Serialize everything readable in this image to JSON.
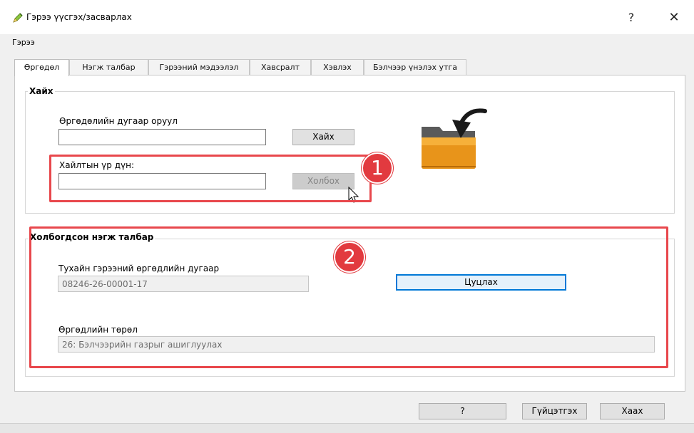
{
  "window": {
    "title": "Гэрээ үүсгэх/засварлах",
    "help_glyph": "?",
    "close_glyph": "✕"
  },
  "menu": {
    "items": [
      "Гэрээ"
    ]
  },
  "tabs": [
    {
      "label": "Өргөдөл",
      "active": true
    },
    {
      "label": "Нэгж талбар",
      "active": false
    },
    {
      "label": "Гэрээний мэдээлэл",
      "active": false
    },
    {
      "label": "Хавсралт",
      "active": false
    },
    {
      "label": "Хэвлэх",
      "active": false
    },
    {
      "label": "Бэлчээр үнэлэх утга",
      "active": false
    }
  ],
  "search_group": {
    "title": "Хайх",
    "app_number_label": "Өргөдөлийн дугаар оруул",
    "app_number_value": "",
    "search_button": "Хайх",
    "result_label": "Хайлтын үр дүн:",
    "result_value": "",
    "link_button": "Холбох"
  },
  "linked_group": {
    "title": "Холбогдсон нэгж талбар",
    "app_number_label": "Тухайн гэрээний өргөдлийн дугаар",
    "app_number_value": "08246-26-00001-17",
    "cancel_button": "Цуцлах",
    "app_type_label": "Өргөдлийн төрөл",
    "app_type_value": "26: Бэлчээрийн газрыг ашиглуулах"
  },
  "annotations": {
    "badge1": "1",
    "badge2": "2",
    "color": "#e23a3f"
  },
  "footer": {
    "help_button": "?",
    "apply_button": "Гүйцэтгэх",
    "close_button": "Хаах"
  },
  "icons": {
    "app": "qgis-pencil-icon",
    "folder": "folder-icon",
    "arrow": "curved-arrow-icon",
    "cursor": "mouse-cursor-icon"
  }
}
